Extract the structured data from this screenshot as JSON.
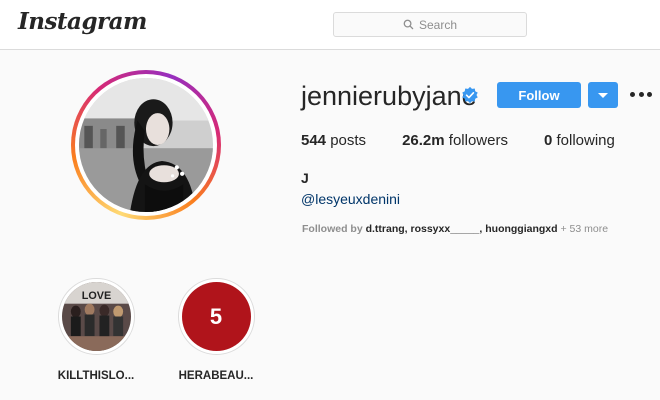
{
  "header": {
    "logo_text": "Instagram",
    "search_placeholder": "Search"
  },
  "profile": {
    "username": "jennierubyjane",
    "verified": true,
    "follow_label": "Follow",
    "stats": [
      {
        "value": "544",
        "label": "posts"
      },
      {
        "value": "26.2m",
        "label": "followers"
      },
      {
        "value": "0",
        "label": "following"
      }
    ],
    "full_name": "J",
    "bio_link": "@lesyeuxdenini",
    "followed_by_prefix": "Followed by",
    "followed_by_names": "d.ttrang, rossyxx_____, huonggiangxd",
    "followed_by_more": "+ 53 more"
  },
  "highlights": [
    {
      "label": "KILLTHISLO...",
      "icon": "group-photo"
    },
    {
      "label": "HERABEAU...",
      "badge": "5"
    }
  ],
  "colors": {
    "accent": "#3897f0",
    "verified": "#3897f0",
    "highlight_red": "#b0141b"
  }
}
